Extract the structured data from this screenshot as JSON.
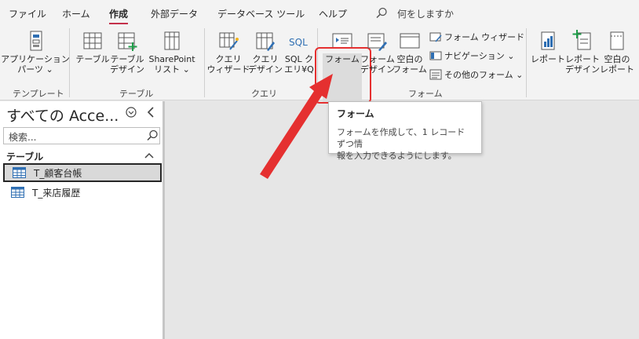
{
  "tabs": [
    "ファイル",
    "ホーム",
    "作成",
    "外部データ",
    "データベース ツール",
    "ヘルプ"
  ],
  "active_tab": "作成",
  "tell_me": "何をしますか",
  "ribbon": {
    "groups": {
      "templates": "テンプレート",
      "tables": "テーブル",
      "queries": "クエリ",
      "forms": "フォーム",
      "reports": ""
    },
    "buttons": {
      "app_parts": [
        "アプリケーション",
        "パーツ ⌄"
      ],
      "table": [
        "テーブル"
      ],
      "table_design": [
        "テーブル",
        "デザイン"
      ],
      "sharepoint": [
        "SharePoint",
        "リスト ⌄"
      ],
      "query_wizard": [
        "クエリ",
        "ウィザード"
      ],
      "query_design": [
        "クエリ",
        "デザイン"
      ],
      "sql_query": [
        "SQL ク",
        "エリ¥Q"
      ],
      "form": [
        "フォーム"
      ],
      "form_design": [
        "フォーム",
        "デザイン"
      ],
      "blank_form": [
        "空白の",
        "フォーム"
      ],
      "form_wizard": "フォーム ウィザード",
      "navigation": "ナビゲーション ⌄",
      "more_forms": "その他のフォーム ⌄",
      "report": [
        "レポート"
      ],
      "report_design": [
        "レポート",
        "デザイン"
      ],
      "blank_report": [
        "空白の",
        "レポート"
      ]
    }
  },
  "tooltip": {
    "title": "フォーム",
    "description": [
      "フォームを作成して、1 レコードずつ情",
      "報を入力できるようにします。"
    ]
  },
  "nav": {
    "title": "すべての Acce...",
    "search_placeholder": "検索...",
    "group": "テーブル",
    "items": [
      {
        "label": "T_顧客台帳",
        "selected": true
      },
      {
        "label": "T_来店履歴",
        "selected": false
      }
    ]
  },
  "colors": {
    "accent": "#c4314b",
    "annotation_red": "#e53030",
    "form_blue": "#2f6fb3",
    "green": "#1e9c48"
  }
}
